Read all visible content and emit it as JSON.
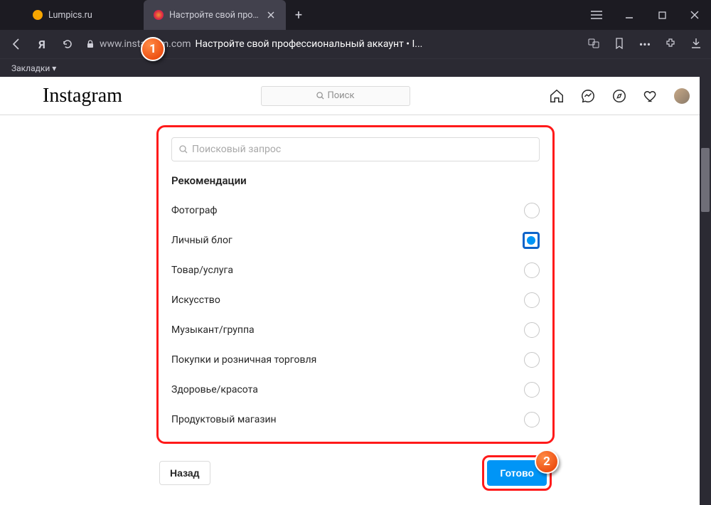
{
  "browser": {
    "tabs": [
      {
        "label": "Lumpics.ru"
      },
      {
        "label": "Настройте свой профе"
      }
    ],
    "url_domain": "www.instagram.com",
    "url_path": "Настройте свой профессиональный аккаунт • I...",
    "bookmarks_label": "Закладки ▾"
  },
  "instagram": {
    "logo": "Instagram",
    "search_placeholder": "Поиск"
  },
  "panel": {
    "query_placeholder": "Поисковый запрос",
    "section_title": "Рекомендации",
    "options": [
      {
        "label": "Фотограф",
        "selected": false
      },
      {
        "label": "Личный блог",
        "selected": true
      },
      {
        "label": "Товар/услуга",
        "selected": false
      },
      {
        "label": "Искусство",
        "selected": false
      },
      {
        "label": "Музыкант/группа",
        "selected": false
      },
      {
        "label": "Покупки и розничная торговля",
        "selected": false
      },
      {
        "label": "Здоровье/красота",
        "selected": false
      },
      {
        "label": "Продуктовый магазин",
        "selected": false
      }
    ],
    "back_label": "Назад",
    "done_label": "Готово"
  },
  "callouts": {
    "one": "1",
    "two": "2"
  }
}
